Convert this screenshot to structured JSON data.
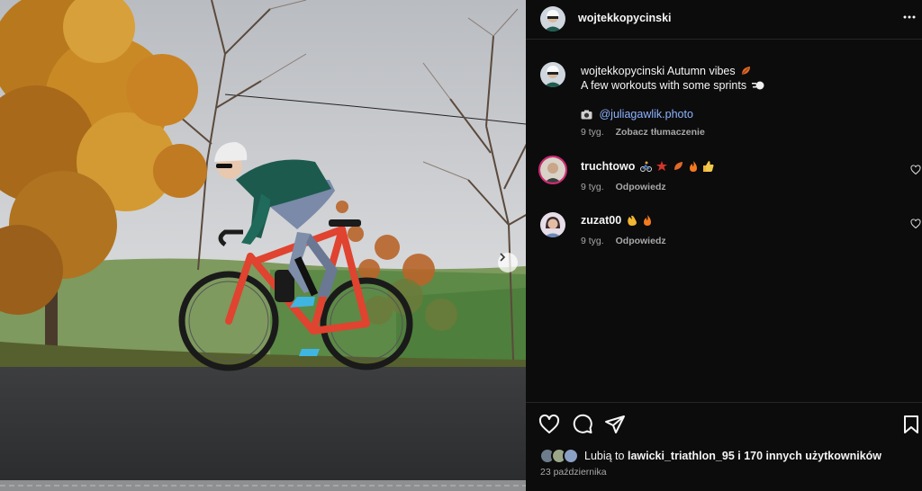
{
  "post": {
    "author": "wojtekkopycinski",
    "caption": {
      "author": "wojtekkopycinski",
      "line1": "Autumn vibes",
      "line2": "A few workouts with some sprints",
      "credit_handle": "@juliagawlik.photo",
      "time": "9 tyg.",
      "translate": "Zobacz tłumaczenie"
    },
    "comments": [
      {
        "user": "truchtowo",
        "time": "9 tyg.",
        "reply": "Odpowiedz"
      },
      {
        "user": "zuzat00",
        "time": "9 tyg.",
        "reply": "Odpowiedz"
      }
    ],
    "likes": {
      "prefix": "Lubią to",
      "user": "lawicki_triathlon_95",
      "suffix": "i 170 innych użytkowników"
    },
    "date": "23 października"
  },
  "icons": {
    "more": "more-horizontal-icon",
    "like": "heart-icon",
    "comment": "comment-icon",
    "share": "share-icon",
    "save": "bookmark-icon",
    "carousel_next": "chevron-right-icon"
  },
  "colors": {
    "panel_bg": "#0c0c0c",
    "text": "#f5f5f5",
    "muted": "#a8a8a8",
    "link": "#8cb4ff",
    "story_ring": "#d62976"
  }
}
